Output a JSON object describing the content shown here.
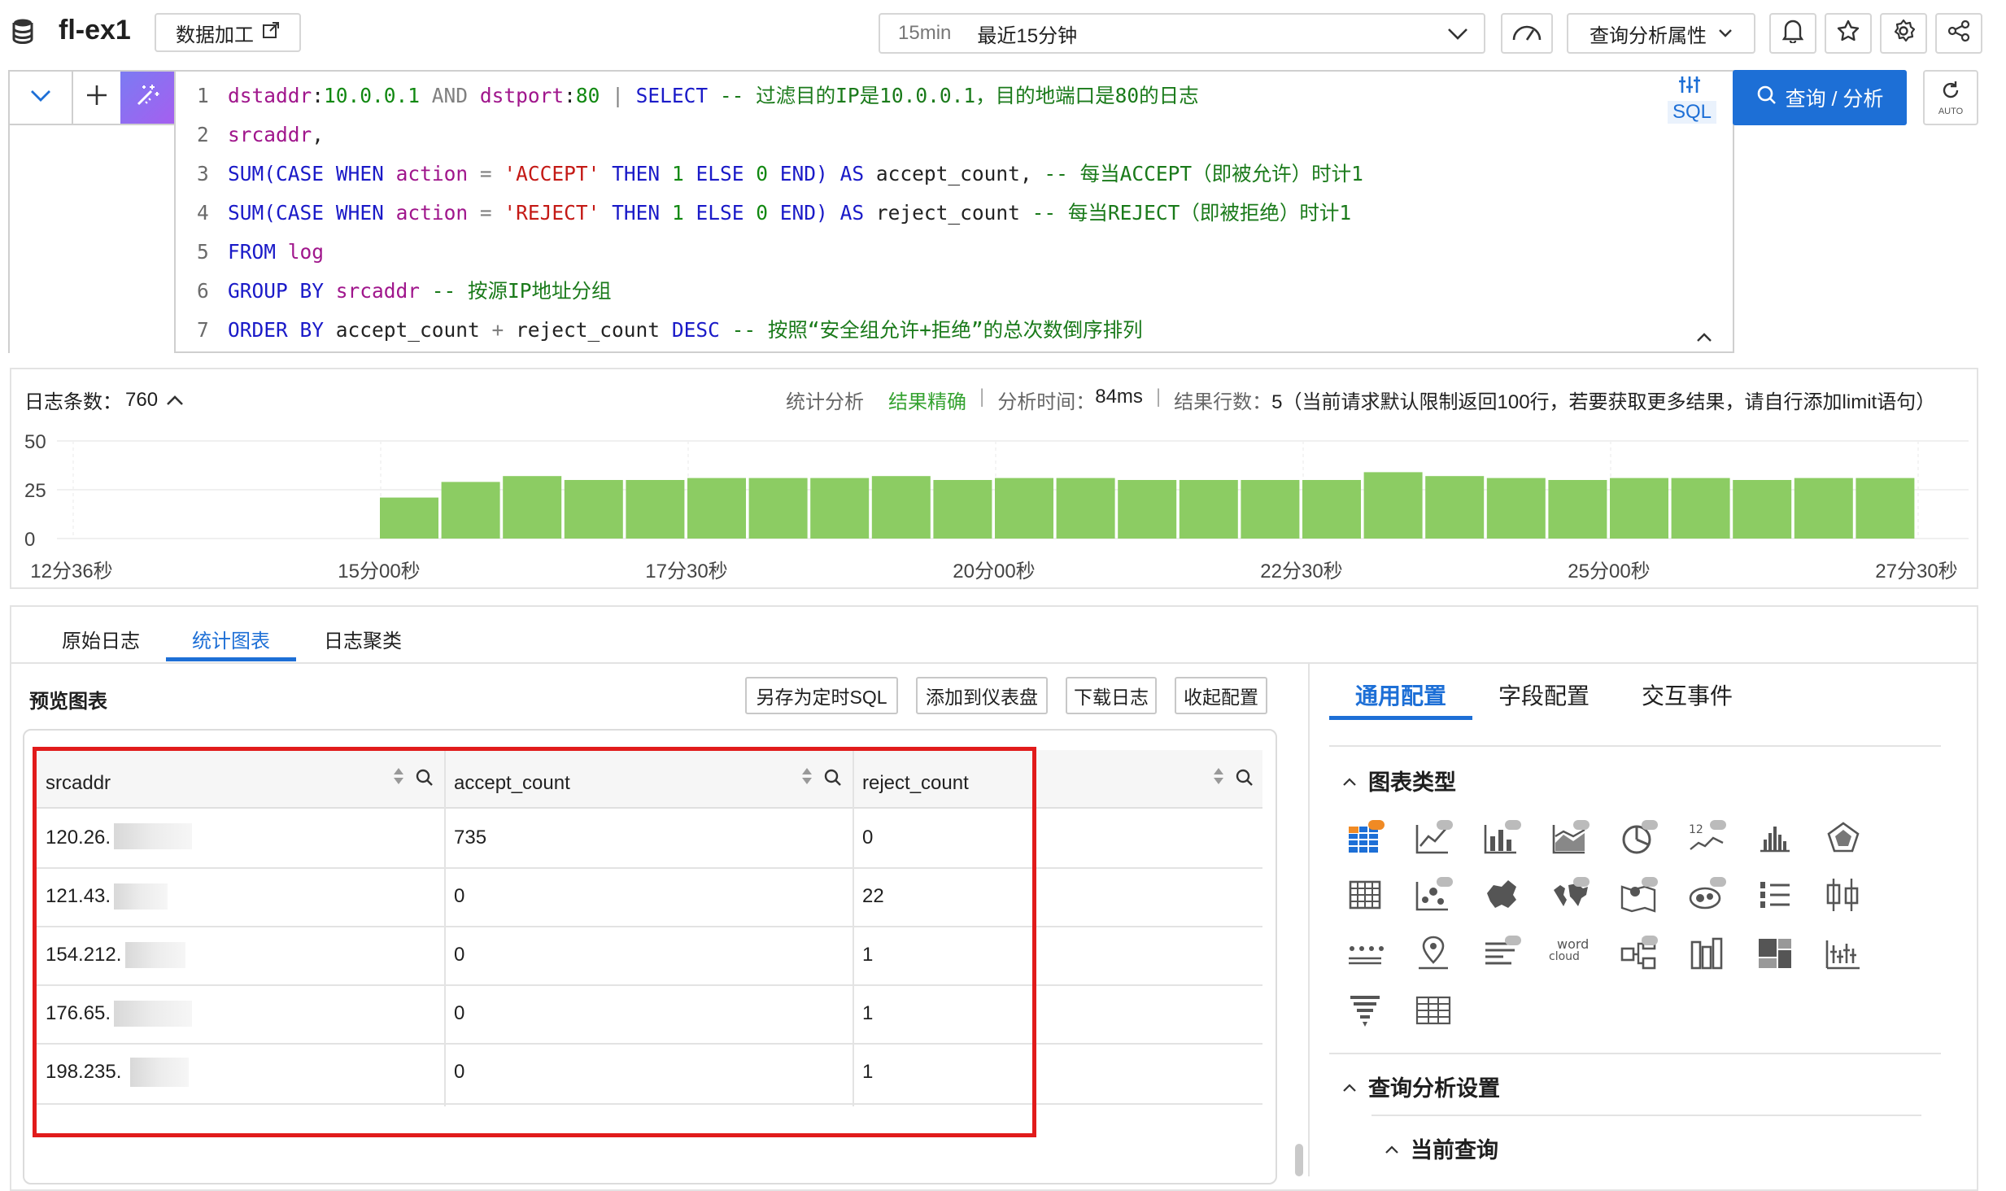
{
  "header": {
    "project": "fl-ex1",
    "data_process_label": "数据加工",
    "time_short": "15min",
    "time_label": "最近15分钟",
    "analysis_props_label": "查询分析属性"
  },
  "query": {
    "lines": [
      {
        "num": "1"
      },
      {
        "num": "2"
      },
      {
        "num": "3"
      },
      {
        "num": "4"
      },
      {
        "num": "5"
      },
      {
        "num": "6"
      },
      {
        "num": "7"
      }
    ],
    "sql_badge": "SQL",
    "search_button": "查询 / 分析",
    "auto_label": "AUTO"
  },
  "code": {
    "l1a": "dstaddr",
    "l1b": ":",
    "l1c": "10.0.0.1",
    "l1d": " AND ",
    "l1e": "dstport",
    "l1f": ":",
    "l1g": "80",
    "l1h": " | ",
    "l1i": "SELECT",
    "l1j": " -- 过滤目的IP是10.0.0.1，目的地端口是80的日志",
    "l2a": "srcaddr",
    "l2b": ",",
    "l3a": "SUM",
    "l3b": "(",
    "l3c": "CASE",
    "l3d": " ",
    "l3e": "WHEN",
    "l3f": " ",
    "l3g": "action",
    "l3h": " = ",
    "l3i": "'ACCEPT'",
    "l3j": " ",
    "l3k": "THEN",
    "l3l": " ",
    "l3m": "1",
    "l3n": " ",
    "l3o": "ELSE",
    "l3p": " ",
    "l3q": "0",
    "l3r": " ",
    "l3s": "END)",
    "l3t": " ",
    "l3u": "AS",
    "l3v": " accept_count, ",
    "l3w": "-- 每当ACCEPT（即被允许）时计1",
    "l4a": "SUM",
    "l4b": "(",
    "l4c": "CASE",
    "l4d": " ",
    "l4e": "WHEN",
    "l4f": " ",
    "l4g": "action",
    "l4h": " = ",
    "l4i": "'REJECT'",
    "l4j": " ",
    "l4k": "THEN",
    "l4l": " ",
    "l4m": "1",
    "l4n": " ",
    "l4o": "ELSE",
    "l4p": " ",
    "l4q": "0",
    "l4r": " ",
    "l4s": "END)",
    "l4t": " ",
    "l4u": "AS",
    "l4v": " reject_count ",
    "l4w": "-- 每当REJECT（即被拒绝）时计1",
    "l5a": "FROM",
    "l5b": " ",
    "l5c": "log",
    "l6a": "GROUP BY",
    "l6b": " ",
    "l6c": "srcaddr",
    "l6d": " -- 按源IP地址分组",
    "l7a": "ORDER BY",
    "l7b": " accept_count ",
    "l7c": "+",
    "l7d": " reject_count ",
    "l7e": "DESC",
    "l7f": " -- 按照“安全组允许+拒绝”的总次数倒序排列"
  },
  "histogram": {
    "log_count_label": "日志条数：",
    "log_count": "760",
    "stat_label": "统计分析",
    "precise_label": "结果精确",
    "time_label": "分析时间：",
    "time_value": "84ms",
    "rows_label": "结果行数：",
    "rows_value": "5（当前请求默认限制返回100行，若要获取更多结果，请自行添加limit语句）",
    "sep": "|"
  },
  "chart_data": {
    "type": "bar",
    "y_ticks": [
      "50",
      "25",
      "0"
    ],
    "ylim": [
      0,
      50
    ],
    "x_ticks": [
      "12分36秒",
      "15分00秒",
      "17分30秒",
      "20分00秒",
      "22分30秒",
      "25分00秒",
      "27分30秒"
    ],
    "values": [
      21,
      29,
      32,
      30,
      30,
      31,
      31,
      31,
      32,
      30,
      31,
      31,
      30,
      30,
      30,
      30,
      34,
      32,
      31,
      30,
      31,
      31,
      30,
      31,
      31
    ],
    "color": "#8ccc63"
  },
  "tabs": {
    "raw": "原始日志",
    "chart": "统计图表",
    "cluster": "日志聚类"
  },
  "preview": {
    "title": "预览图表",
    "save_sql": "另存为定时SQL",
    "add_dashboard": "添加到仪表盘",
    "download": "下载日志",
    "collapse": "收起配置"
  },
  "table": {
    "columns": [
      "srcaddr",
      "accept_count",
      "reject_count"
    ],
    "rows": [
      {
        "srcaddr": "120.26.",
        "accept": "735",
        "reject": "0"
      },
      {
        "srcaddr": "121.43.",
        "accept": "0",
        "reject": "22"
      },
      {
        "srcaddr": "154.212.",
        "accept": "0",
        "reject": "1"
      },
      {
        "srcaddr": "176.65.",
        "accept": "0",
        "reject": "1"
      },
      {
        "srcaddr": "198.235.",
        "accept": "0",
        "reject": "1"
      }
    ]
  },
  "config": {
    "tab_general": "通用配置",
    "tab_field": "字段配置",
    "tab_interaction": "交互事件",
    "chart_type_label": "图表类型",
    "query_settings_label": "查询分析设置",
    "current_query_label": "当前查询",
    "pro": "Pro",
    "word_cloud_a": "word",
    "word_cloud_b": "cloud",
    "num_badge": "12"
  },
  "colors": {
    "accent": "#1d6fd6",
    "bar": "#8ccc63",
    "highlight": "#e11b1b",
    "magic": "#8d6df3"
  }
}
